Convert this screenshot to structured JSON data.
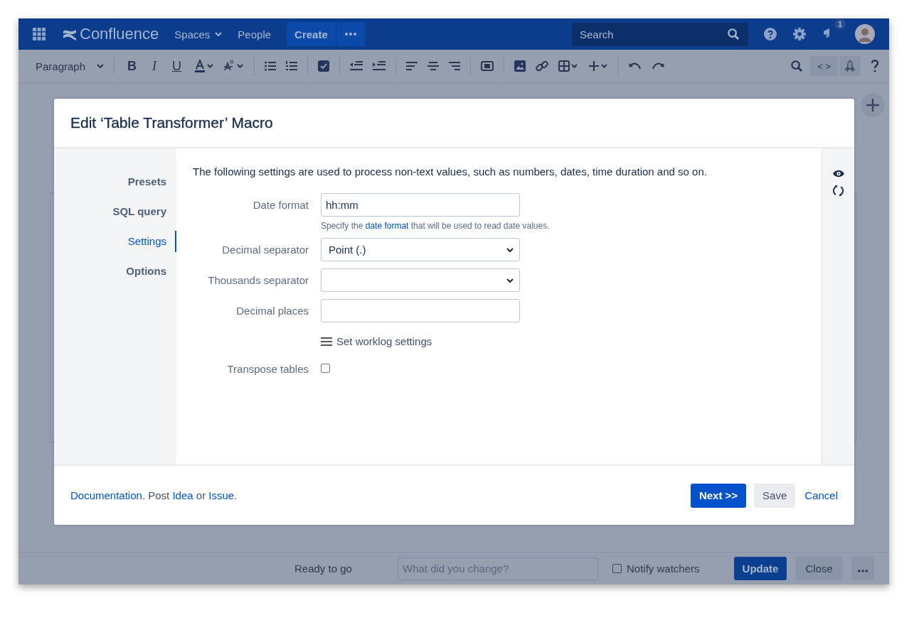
{
  "navbar": {
    "logo": "Confluence",
    "links": [
      {
        "label": "Spaces",
        "dropdown": true
      },
      {
        "label": "People",
        "dropdown": false
      }
    ],
    "create": "Create",
    "search": {
      "placeholder": "Search"
    },
    "notifications": "1"
  },
  "toolbar": {
    "style": "Paragraph",
    "bold": "B",
    "italic": "I",
    "underline": "U",
    "source": "< >"
  },
  "dialog": {
    "title": "Edit ‘Table Transformer’ Macro",
    "nav": [
      {
        "label": "Presets",
        "selected": false
      },
      {
        "label": "SQL query",
        "selected": false
      },
      {
        "label": "Settings",
        "selected": true
      },
      {
        "label": "Options",
        "selected": false
      }
    ],
    "description": "The following settings are used to process non-text values, such as numbers, dates, time duration and so on.",
    "fields": [
      {
        "kind": "text",
        "label": "Date format",
        "value": "hh:mm",
        "help": {
          "before": "Specify the ",
          "link": "date format",
          "after": " that will be used to read date values."
        }
      },
      {
        "kind": "select",
        "label": "Decimal separator",
        "value": "Point (.)"
      },
      {
        "kind": "select",
        "label": "Thousands separator"
      },
      {
        "kind": "text",
        "label": "Decimal places"
      },
      {
        "kind": "link",
        "label": "Set worklog settings"
      },
      {
        "kind": "checkbox",
        "label": "Transpose tables",
        "checked": false
      }
    ],
    "footer": [
      {
        "text": "Documentation",
        "link": true
      },
      {
        "text": ". Post ",
        "link": false
      },
      {
        "text": "Idea",
        "link": true
      },
      {
        "text": " or ",
        "link": false
      },
      {
        "text": "Issue",
        "link": true
      },
      {
        "text": ".",
        "link": false
      }
    ],
    "buttons": [
      {
        "label": "Next >>",
        "kind": "primary"
      },
      {
        "label": "Save",
        "kind": "default"
      },
      {
        "label": "Cancel",
        "kind": "link"
      }
    ]
  },
  "bottom_bar": {
    "status": "Ready to go",
    "comment": {
      "placeholder": "What did you change?"
    },
    "notify": {
      "label": "Notify watchers",
      "checked": false
    },
    "update": "Update",
    "close": "Close"
  }
}
